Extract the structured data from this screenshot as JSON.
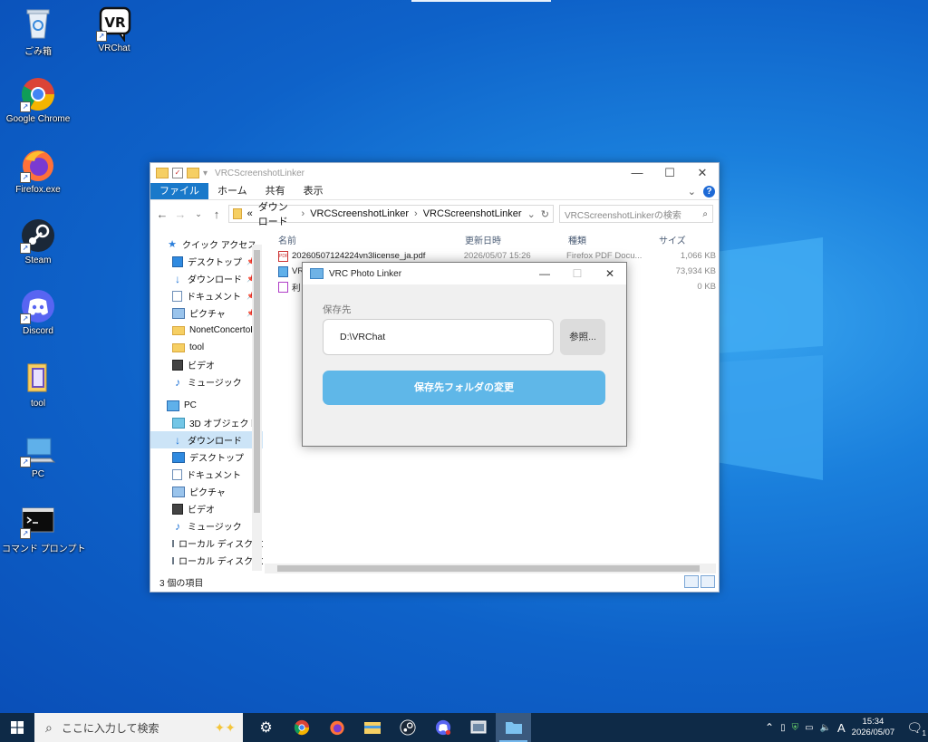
{
  "desktop": {
    "icons": [
      {
        "label": "ごみ箱",
        "icon": "recycle-bin-icon"
      },
      {
        "label": "VRChat",
        "icon": "vrchat-icon"
      },
      {
        "label": "Google Chrome",
        "icon": "chrome-icon"
      },
      {
        "label": "Firefox.exe",
        "icon": "firefox-icon"
      },
      {
        "label": "Steam",
        "icon": "steam-icon"
      },
      {
        "label": "Discord",
        "icon": "discord-icon"
      },
      {
        "label": "tool",
        "icon": "folder-icon"
      },
      {
        "label": "PC",
        "icon": "pc-icon"
      },
      {
        "label": "コマンド プロンプト",
        "icon": "cmd-icon"
      }
    ],
    "vr_badge": "VR",
    "shortcut_glyph": "↗"
  },
  "explorer": {
    "title": "VRCScreenshotLinker",
    "ribbon": {
      "file": "ファイル",
      "home": "ホーム",
      "share": "共有",
      "view": "表示",
      "help": "?"
    },
    "breadcrumb": {
      "prefix": "«",
      "items": [
        "ダウンロード",
        "VRCScreenshotLinker",
        "VRCScreenshotLinker"
      ]
    },
    "search_placeholder": "VRCScreenshotLinkerの検索",
    "nav": {
      "quick_access": "クイック アクセス",
      "quick_items": [
        "デスクトップ",
        "ダウンロード",
        "ドキュメント",
        "ピクチャ",
        "NonetConcertoD",
        "tool",
        "ビデオ",
        "ミュージック"
      ],
      "pc": "PC",
      "pc_items": [
        "3D オブジェクト",
        "ダウンロード",
        "デスクトップ",
        "ドキュメント",
        "ピクチャ",
        "ビデオ",
        "ミュージック",
        "ローカル ディスク (C",
        "ローカル ディスク (D"
      ]
    },
    "columns": {
      "name": "名前",
      "date": "更新日時",
      "type": "種類",
      "size": "サイズ"
    },
    "files": [
      {
        "name": "20260507124224vn3license_ja.pdf",
        "date": "2026/05/07 15:26",
        "type": "Firefox PDF Docu...",
        "size": "1,066 KB"
      },
      {
        "name": "VR",
        "date": "",
        "type": "",
        "size": "73,934 KB"
      },
      {
        "name": "利",
        "date": "",
        "type": "",
        "size": "0 KB"
      }
    ],
    "status": "3 個の項目"
  },
  "dialog": {
    "title": "VRC Photo Linker",
    "label": "保存先",
    "path_value": "D:\\VRChat",
    "browse": "参照...",
    "change_button": "保存先フォルダの変更"
  },
  "taskbar": {
    "search_placeholder": "ここに入力して検索",
    "time": "15:34",
    "date": "2026/05/07",
    "ime": "A",
    "notifications": "1"
  }
}
